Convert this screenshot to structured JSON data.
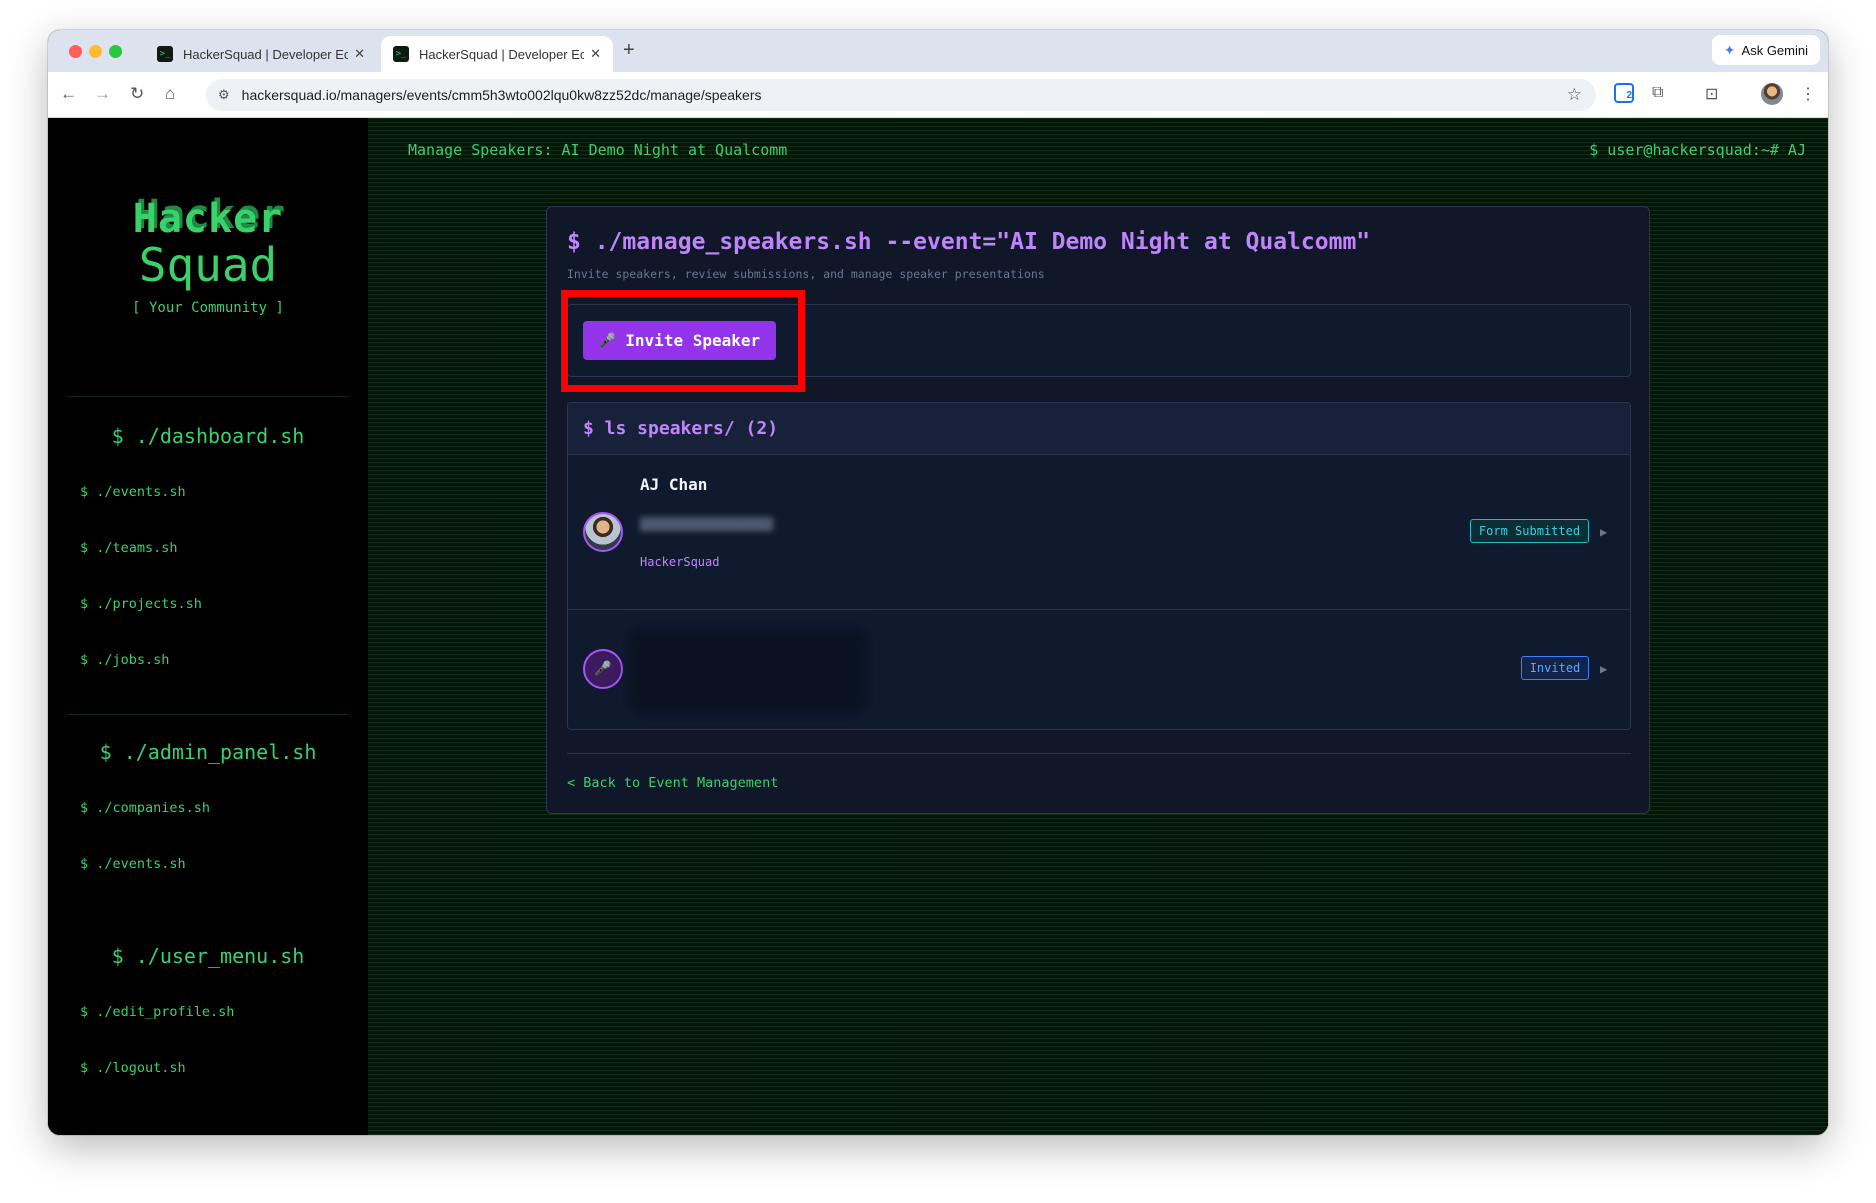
{
  "browser": {
    "tabs": [
      {
        "title": "HackerSquad | Developer Eco",
        "active": false
      },
      {
        "title": "HackerSquad | Developer Eco",
        "active": true
      }
    ],
    "new_tab": "+",
    "ask_gemini": "Ask Gemini",
    "url": "hackersquad.io/managers/events/cmm5h3wto002lqu0kw8zz52dc/manage/speakers",
    "extension_badge_count": "2"
  },
  "sidebar": {
    "logo_hacker": "Hacker",
    "logo_squad": "Squad",
    "logo_tagline": "[ Your Community ]",
    "sections": [
      {
        "heading": "$ ./dashboard.sh",
        "items": [
          "$ ./events.sh",
          "$ ./teams.sh",
          "$ ./projects.sh",
          "$ ./jobs.sh"
        ]
      },
      {
        "heading": "$ ./admin_panel.sh",
        "items": [
          "$ ./companies.sh",
          "$ ./events.sh"
        ]
      },
      {
        "heading": "$ ./user_menu.sh",
        "items": [
          "$ ./edit_profile.sh",
          "$ ./logout.sh"
        ]
      }
    ]
  },
  "header": {
    "page_title": "Manage Speakers: AI Demo Night at Qualcomm",
    "user_prompt": "$ user@hackersquad:~# AJ"
  },
  "card": {
    "title": "$ ./manage_speakers.sh --event=\"AI Demo Night at Qualcomm\"",
    "subtitle": "Invite speakers, review submissions, and manage speaker presentations",
    "invite_button": "Invite Speaker",
    "list_heading": "$ ls speakers/ (2)",
    "speakers": [
      {
        "name": "AJ Chan",
        "company": "HackerSquad",
        "status": "Form Submitted"
      },
      {
        "name": "",
        "company": "",
        "status": "Invited"
      }
    ],
    "back_link": "< Back to Event Management"
  },
  "colors": {
    "terminal_green": "#3ad16b",
    "accent_purple": "#c084fc",
    "button_purple": "#9333ea",
    "status_submitted": "#38d0dc",
    "status_invited": "#60a5fa",
    "highlight_red": "#ff0000"
  },
  "icons": [
    "close-icon",
    "back-arrow-icon",
    "forward-arrow-icon",
    "reload-icon",
    "home-icon",
    "site-settings-icon",
    "bookmark-star-icon",
    "extensions-icon",
    "tab-search-icon",
    "menu-dots-icon",
    "microphone-icon",
    "chevron-right-icon"
  ]
}
